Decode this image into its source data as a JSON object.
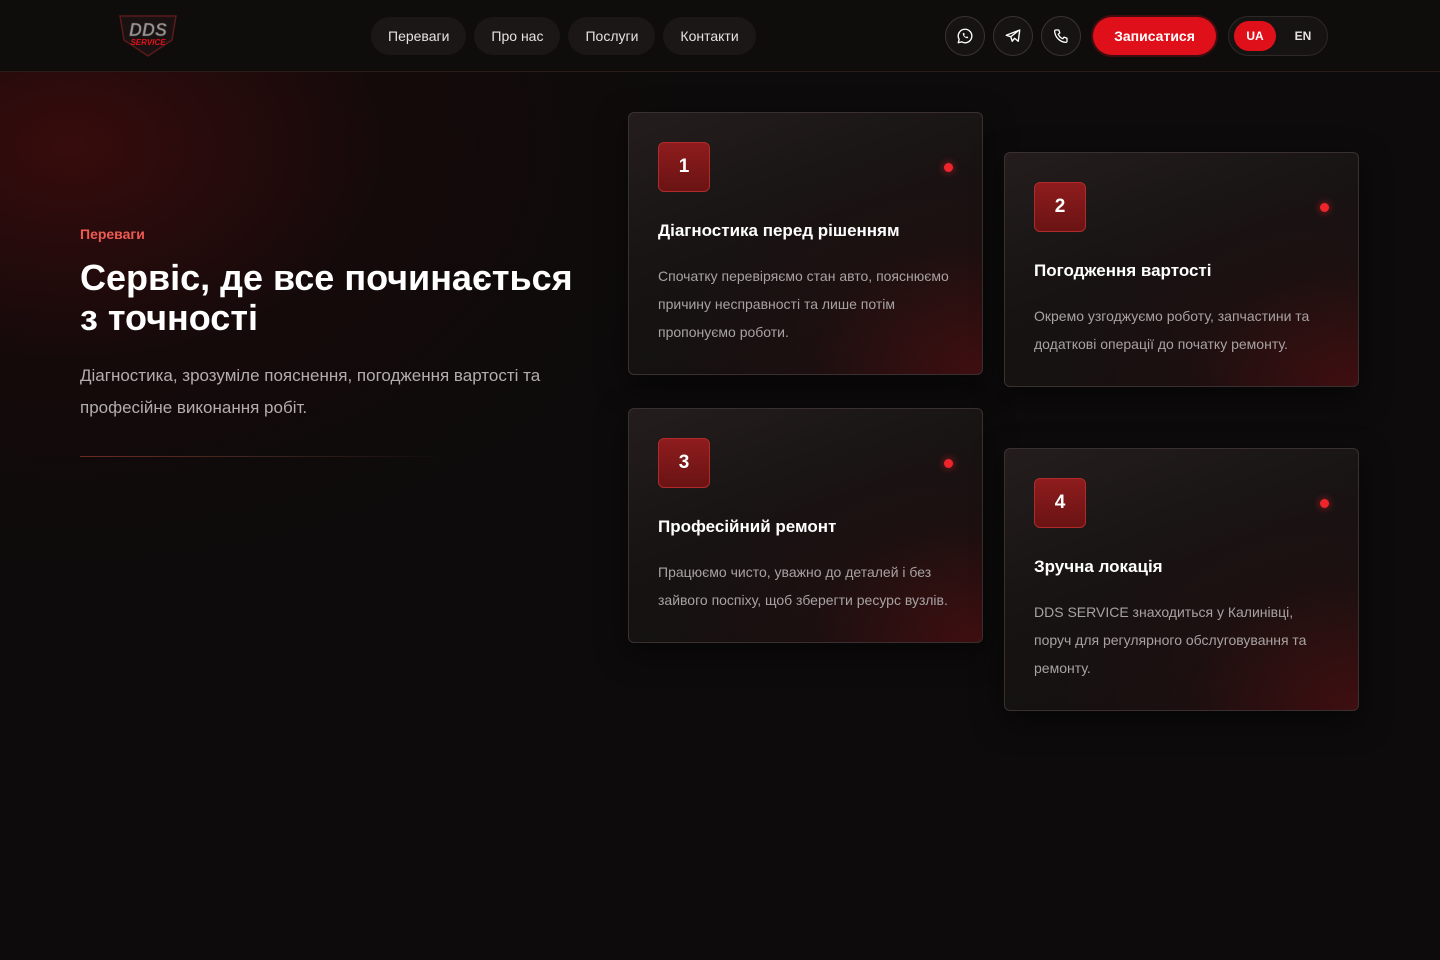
{
  "header": {
    "logo": {
      "text": "DDS",
      "subtext": "SERVICE"
    },
    "nav": [
      "Переваги",
      "Про нас",
      "Послуги",
      "Контакти"
    ],
    "icons": [
      "whatsapp-icon",
      "telegram-icon",
      "phone-icon"
    ],
    "cta_label": "Записатися",
    "lang": {
      "active": "UA",
      "other": "EN"
    }
  },
  "intro": {
    "eyebrow": "Переваги",
    "title": "Сервіс, де все починається з точності",
    "lead": "Діагностика, зрозуміле пояснення, погодження вартості та професійне виконання робіт."
  },
  "cards": [
    {
      "number": "1",
      "title": "Діагностика перед рішенням",
      "text": "Спочатку перевіряємо стан авто, пояснюємо причину несправності та лише потім пропонуємо роботи."
    },
    {
      "number": "2",
      "title": "Погодження вартості",
      "text": "Окремо узгоджуємо роботу, запчастини та додаткові операції до початку ремонту."
    },
    {
      "number": "3",
      "title": "Професійний ремонт",
      "text": "Працюємо чисто, уважно до деталей і без зайвого поспіху, щоб зберегти ресурс вузлів."
    },
    {
      "number": "4",
      "title": "Зручна локація",
      "text": "DDS SERVICE знаходиться у Калинівці, поруч для регулярного обслуговування та ремонту."
    }
  ],
  "colors": {
    "accent": "#e0101b",
    "eyebrow": "#ef5a52",
    "background": "#0d0b0b"
  }
}
